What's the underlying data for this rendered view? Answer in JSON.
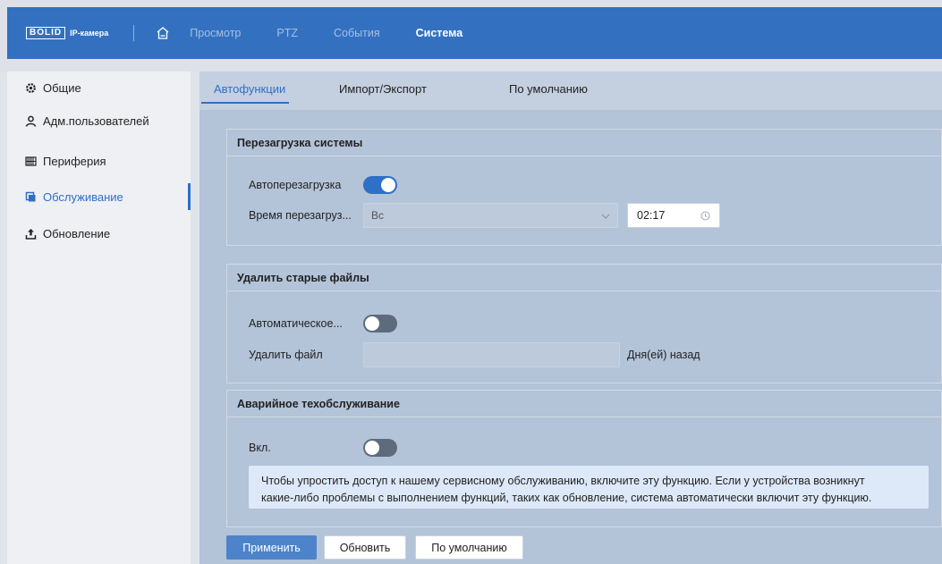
{
  "brand": {
    "logo_mark": "BOLID",
    "logo_text": "IP-камера"
  },
  "nav": {
    "home_icon": "home-icon",
    "items": [
      {
        "label": "Просмотр"
      },
      {
        "label": "PTZ"
      },
      {
        "label": "События"
      },
      {
        "label": "Система",
        "active": true
      }
    ]
  },
  "sidebar": {
    "items": [
      {
        "label": "Общие",
        "icon": "gear-icon"
      },
      {
        "label": "Адм.пользователей",
        "icon": "user-icon"
      },
      {
        "label": "Периферия",
        "icon": "peripheral-icon"
      },
      {
        "label": "Обслуживание",
        "icon": "maintenance-icon",
        "active": true
      },
      {
        "label": "Обновление",
        "icon": "upload-icon"
      }
    ]
  },
  "tabs": [
    {
      "label": "Автофункции",
      "active": true
    },
    {
      "label": "Импорт/Экспорт"
    },
    {
      "label": "По умолчанию"
    }
  ],
  "reboot": {
    "title": "Перезагрузка системы",
    "auto_label": "Автоперезагрузка",
    "auto_on": true,
    "time_label": "Время перезагруз...",
    "day_value": "Вс",
    "time_value": "02:17"
  },
  "delete_files": {
    "title": "Удалить старые файлы",
    "auto_label": "Автоматическое...",
    "auto_on": false,
    "delete_label": "Удалить файл",
    "days_value": "",
    "days_suffix": "Дня(ей) назад"
  },
  "emergency": {
    "title": "Аварийное техобслуживание",
    "enable_label": "Вкл.",
    "enable_on": false,
    "notice_line1": "Чтобы упростить доступ к нашему сервисному обслуживанию, включите эту функцию. Если у устройства возникнут",
    "notice_line2": "какие-либо проблемы с выполнением функций, таких как обновление, система автоматически включит эту функцию."
  },
  "buttons": {
    "apply": "Применить",
    "refresh": "Обновить",
    "default": "По умолчанию"
  },
  "colors": {
    "accent": "#2e6fc7",
    "topbar": "#3371c0",
    "main_bg": "#b3c3d8"
  }
}
